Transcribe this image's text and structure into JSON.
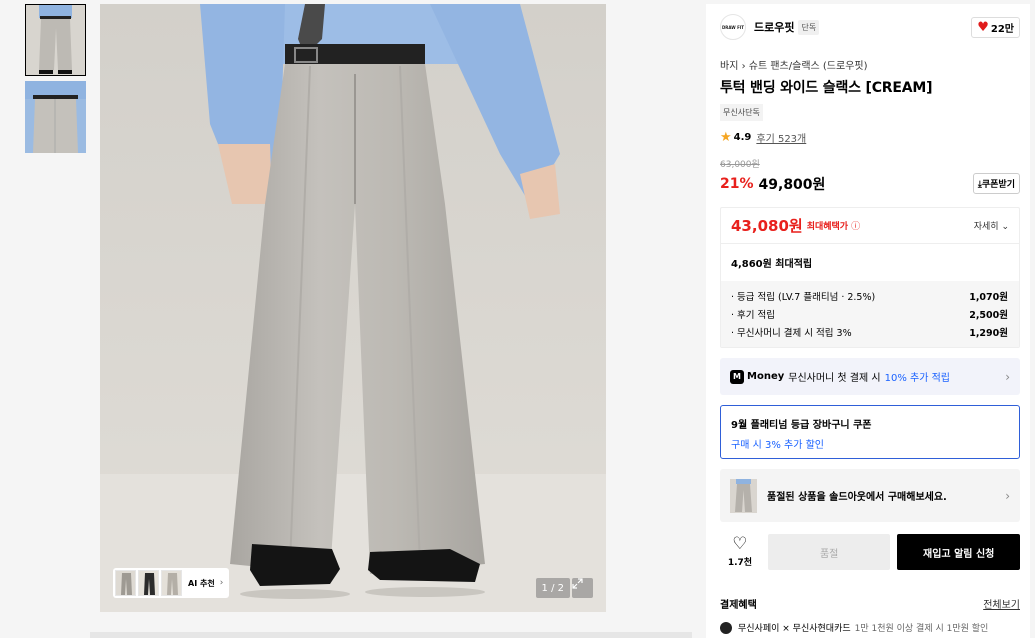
{
  "gallery": {
    "pager": "1 / 2",
    "ai_label": "AI 추천"
  },
  "brand": {
    "logo_text": "DRAW FIT",
    "name": "드로우핏",
    "badge": "단독",
    "likes": "22만"
  },
  "product": {
    "breadcrumb_1": "바지",
    "breadcrumb_2": "슈트 팬츠/슬랙스 (드로우핏)",
    "title": "투턱 밴딩 와이드 슬랙스 [CREAM]",
    "tag": "무신사단독",
    "rating": "4.9",
    "reviews": "후기 523개",
    "original_price": "63,000원",
    "discount": "21%",
    "price": "49,800원",
    "coupon_button": "쿠폰받기"
  },
  "benefit": {
    "max_price": "43,080원",
    "max_label": "최대혜택가",
    "detail_label": "자세히",
    "points": "4,860원 최대적립",
    "lines": [
      {
        "label": "· 등급 적립 (LV.7 플래티넘 · 2.5%)",
        "value": "1,070원"
      },
      {
        "label": "· 후기 적립",
        "value": "2,500원"
      },
      {
        "label": "· 무신사머니 결제 시 적립 3%",
        "value": "1,290원"
      }
    ]
  },
  "money": {
    "icon": "M",
    "brand": "Money",
    "text": "무신사머니 첫 결제 시",
    "highlight": "10% 추가 적립"
  },
  "cart_coupon": {
    "title": "9월 플래티넘 등급 장바구니 쿠폰",
    "sub": "구매 시 3% 추가 할인"
  },
  "soldout": {
    "text": "품절된 상품을 솔드아웃에서 구매해보세요."
  },
  "actions": {
    "like_count": "1.7천",
    "soldout_button": "품절",
    "restock_button": "재입고 알림 신청"
  },
  "payment": {
    "title": "결제혜택",
    "all_label": "전체보기",
    "line_main": "무신사페이 × 무신사현대카드",
    "line_sub": "1만 1천원 이상 결제 시 1만원 할인"
  },
  "colors": {
    "accent_red": "#e8201c",
    "accent_blue": "#1a62ff",
    "heart": "#e01b1b",
    "star": "#f5a623"
  }
}
